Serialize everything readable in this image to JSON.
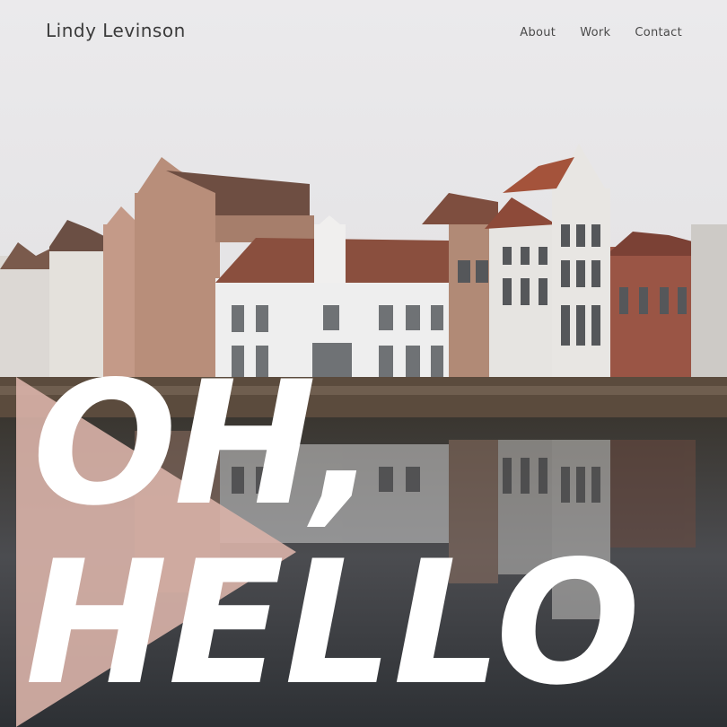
{
  "header": {
    "site_name": "Lindy Levinson",
    "nav": [
      {
        "label": "About"
      },
      {
        "label": "Work"
      },
      {
        "label": "Contact"
      }
    ]
  },
  "hero": {
    "line_1": "OH,",
    "line_2": "HELLO"
  },
  "colors": {
    "sky": "#e7e6e8",
    "accent_triangle": "#d9b3a8",
    "water": "#2c3035",
    "text_white": "#ffffff",
    "text_dark": "#3b3b3b"
  }
}
